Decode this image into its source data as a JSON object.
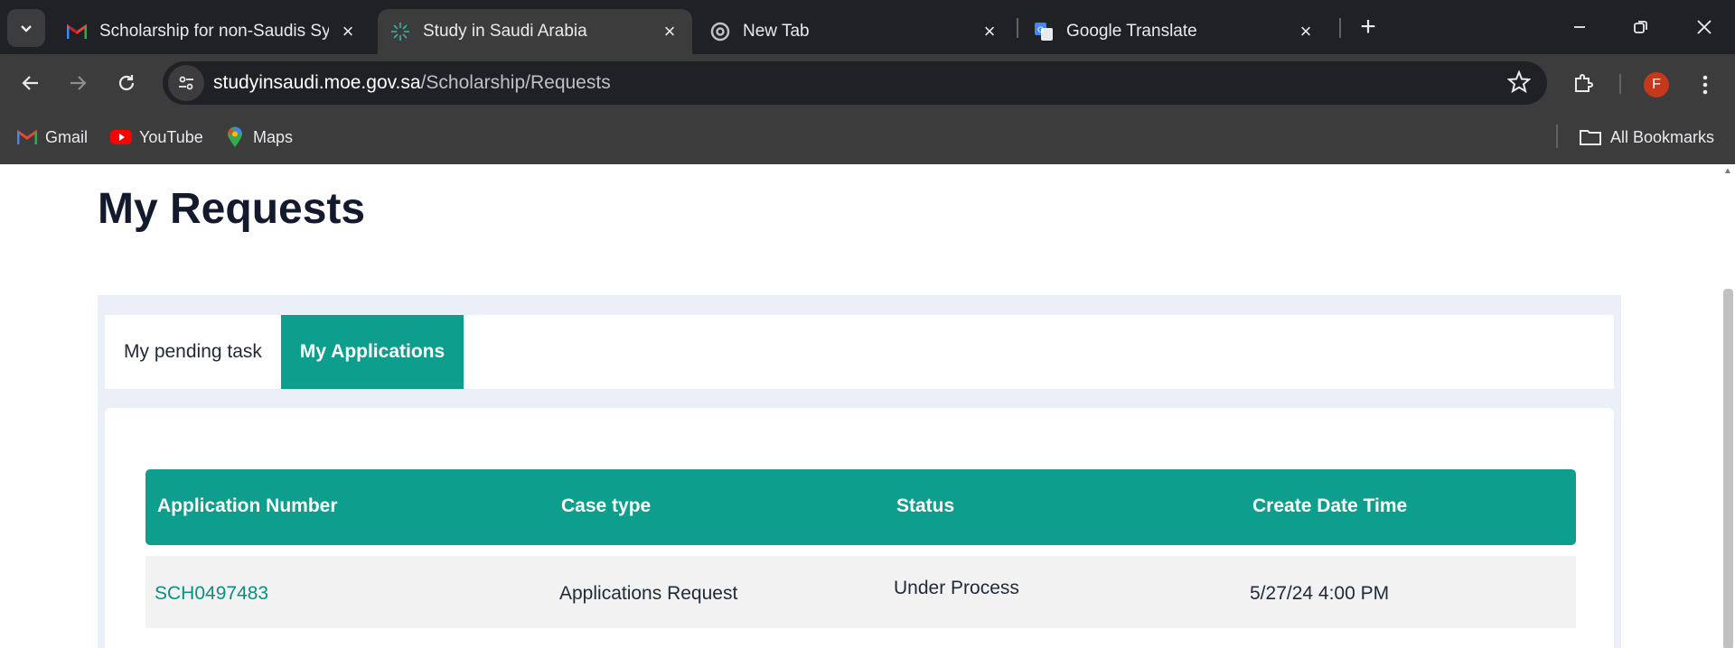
{
  "browser": {
    "tabs": [
      {
        "title": "Scholarship for non-Saudis Syst",
        "favicon": "gmail-icon",
        "active": false
      },
      {
        "title": "Study in Saudi Arabia",
        "favicon": "study-in-saudi-icon",
        "active": true
      },
      {
        "title": "New Tab",
        "favicon": "chrome-icon",
        "active": false
      },
      {
        "title": "Google Translate",
        "favicon": "google-translate-icon",
        "active": false
      }
    ],
    "new_tab_label": "+",
    "address": {
      "host": "studyinsaudi.moe.gov.sa",
      "path": "/Scholarship/Requests"
    },
    "profile_initial": "F",
    "bookmarks": [
      {
        "label": "Gmail",
        "icon": "gmail-icon"
      },
      {
        "label": "YouTube",
        "icon": "youtube-icon"
      },
      {
        "label": "Maps",
        "icon": "maps-icon"
      }
    ],
    "all_bookmarks_label": "All Bookmarks"
  },
  "page": {
    "title": "My Requests",
    "tabs": [
      {
        "label": "My pending task",
        "active": false
      },
      {
        "label": "My Applications",
        "active": true
      }
    ],
    "table": {
      "headers": [
        "Application Number",
        "Case type",
        "Status",
        "Create Date Time"
      ],
      "rows": [
        {
          "application_number": "SCH0497483",
          "case_type": "Applications Request",
          "status": "Under Process",
          "created": "5/27/24 4:00 PM"
        }
      ]
    }
  },
  "colors": {
    "accent": "#0d9e8e",
    "panel": "#ebeff8",
    "browser_dark": "#202124",
    "browser_toolbar": "#3c3c3c"
  }
}
